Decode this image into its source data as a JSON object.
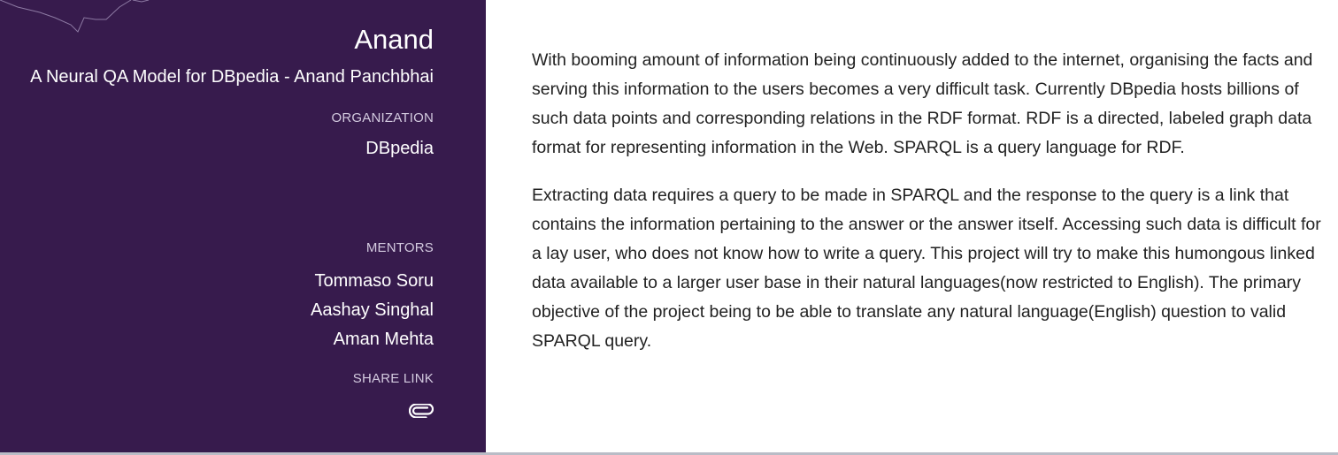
{
  "sidebar": {
    "student_name": "Anand",
    "project_title": "A Neural QA Model for DBpedia - Anand Panchbhai",
    "organization_label": "ORGANIZATION",
    "organization": "DBpedia",
    "mentors_label": "MENTORS",
    "mentors": [
      "Tommaso Soru",
      "Aashay Singhal",
      "Aman Mehta"
    ],
    "share_label": "SHARE LINK",
    "share_icon": "paperclip-icon"
  },
  "description": {
    "paragraphs": [
      "With booming amount of information being continuously added to the internet, organising the facts and serving this information to the users becomes a very difficult task. Currently DBpedia hosts billions of such data points and corresponding relations in the RDF format. RDF is a directed, labeled graph data format for representing information in the Web. SPARQL is a query language for RDF.",
      "Extracting data requires a query to be made in SPARQL and the response to the query is a link that contains the information pertaining to the answer or the answer itself. Accessing such data is difficult for a lay user, who does not know how to write a query. This project will try to make this humongous linked data available to a larger user base in their natural languages(now restricted to English). The primary objective of the project being to be able to translate any natural language(English) question to valid SPARQL query."
    ]
  },
  "colors": {
    "sidebar_bg": "#371b4d",
    "sidebar_text": "#ffffff",
    "sidebar_label": "#d4cbe0",
    "body_text": "#222222",
    "bottom_bar": "#b9bcc6"
  }
}
